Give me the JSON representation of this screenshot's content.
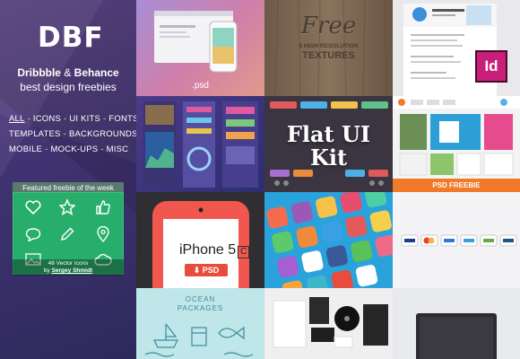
{
  "brand": {
    "logo": "DBF",
    "tagline_part1": "Dribbble",
    "tagline_amp": " & ",
    "tagline_part2": "Behance",
    "tagline_line2": "best design freebies"
  },
  "nav": {
    "rows": [
      [
        "ALL",
        "ICONS",
        "UI KITS",
        "FONTS"
      ],
      [
        "TEMPLATES",
        "BACKGROUNDS"
      ],
      [
        "MOBILE",
        "MOCK-UPS",
        "MISC"
      ]
    ],
    "separator": "-"
  },
  "featured": {
    "label": "Featured freebie of the week",
    "caption_line1": "48 Vector Icons",
    "caption_by": "by",
    "caption_author": "Sergey Shmidt",
    "icons": [
      "heart-icon",
      "star-icon",
      "thumbs-up-icon",
      "chat-icon",
      "pencil-icon",
      "location-pin-icon",
      "picture-icon",
      "cloud-icon"
    ]
  },
  "tiles": {
    "t1_caption": ".psd",
    "t2_free": "Free",
    "t2_sub1": "5 HIGH RESOLUTION",
    "t2_sub2": "TEXTURES",
    "t3_badge": "Id",
    "t5_title1": "Flat UI",
    "t5_title2": "Kit",
    "t6_banner": "PSD FREEBIE",
    "t7_model": "iPhone 5",
    "t7_badge": "C",
    "t7_button": "⬇ PSD",
    "t10_title1": "OCEAN",
    "t10_title2": "PACKAGES"
  },
  "colors": {
    "sidebar": "#3f3270",
    "featured_green": "#27ae6b",
    "psd_orange": "#f07a2a",
    "psd_red": "#e84c3d",
    "indesign_pink": "#c8207a",
    "flat_blue": "#2aa2dc"
  }
}
